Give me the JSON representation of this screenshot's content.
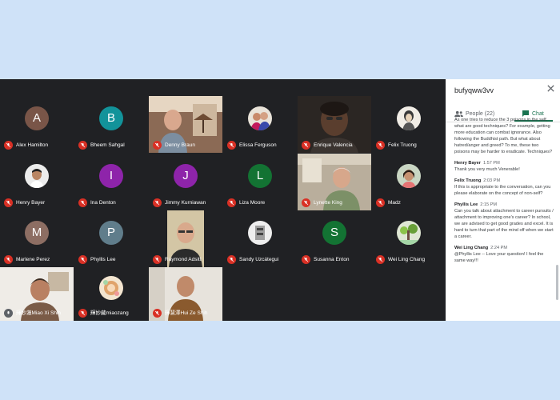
{
  "meeting": {
    "participants": [
      {
        "name": "Alex Hamilton",
        "initial": "A",
        "color": "#795548"
      },
      {
        "name": "Bheem Sahgal",
        "initial": "B",
        "color": "#12939a"
      },
      {
        "name": "Denny Braun",
        "video": true
      },
      {
        "name": "Elissa Ferguson",
        "photo": true
      },
      {
        "name": "Enrique Valencia",
        "video": true
      },
      {
        "name": "Felix Truong",
        "photo": true
      },
      {
        "name": "Henry Bayer",
        "photo": true
      },
      {
        "name": "Ina Denton",
        "initial": "I",
        "color": "#8e24aa"
      },
      {
        "name": "Jimmy Kurniawan",
        "initial": "J",
        "color": "#8e24aa"
      },
      {
        "name": "Liza Moore",
        "initial": "L",
        "color": "#137333"
      },
      {
        "name": "Lynette King",
        "video": true
      },
      {
        "name": "Madz",
        "photo": true
      },
      {
        "name": "Marlene Perez",
        "initial": "M",
        "color": "#8d6e63"
      },
      {
        "name": "Phyllis Lee",
        "initial": "P",
        "color": "#607d8b"
      },
      {
        "name": "Raymond Adsitt",
        "video": true
      },
      {
        "name": "Sandy Uzcátegui",
        "photo": true
      },
      {
        "name": "Susanna Enton",
        "initial": "S",
        "color": "#137333"
      },
      {
        "name": "Wei Ling Chang",
        "photo": true
      },
      {
        "name": "輝妙蓮Miao Xi Shih",
        "video": true
      },
      {
        "name": "輝妙藏miaozang",
        "photo": true
      },
      {
        "name": "輝慧澤Hui Ze Shih",
        "video": true
      }
    ]
  },
  "panel": {
    "title": "bufyqww3vv",
    "tab_people": "People (22)",
    "tab_chat": "Chat",
    "messages": [
      {
        "sender": "",
        "time": "",
        "text": "As one tries to reduce the 3 poisons in the self, what are good techniques? For example, getting more education can combat ignorance. Also following the Buddhist path. But what about hatred/anger and greed? To me, these two poisons may be harder to eradicate. Techniques?"
      },
      {
        "sender": "Henry Bayer",
        "time": "1:57 PM",
        "text": "Thank you very much Venerable!"
      },
      {
        "sender": "Felix Truong",
        "time": "2:03 PM",
        "text": "If this is appropriate to the conversation, can you please elaborate on the concept of non-self?"
      },
      {
        "sender": "Phyllis Lee",
        "time": "2:15 PM",
        "text": "Can you talk about attachment to career pursuits / attachment to improving one's career? In school, we are advised to get good grades and excel. It is hard to turn that part of the mind off when we start a career."
      },
      {
        "sender": "Wei Ling Chang",
        "time": "2:24 PM",
        "text": "@Phyllis Lee -- Love your question! I feel the same way!!!"
      }
    ]
  }
}
